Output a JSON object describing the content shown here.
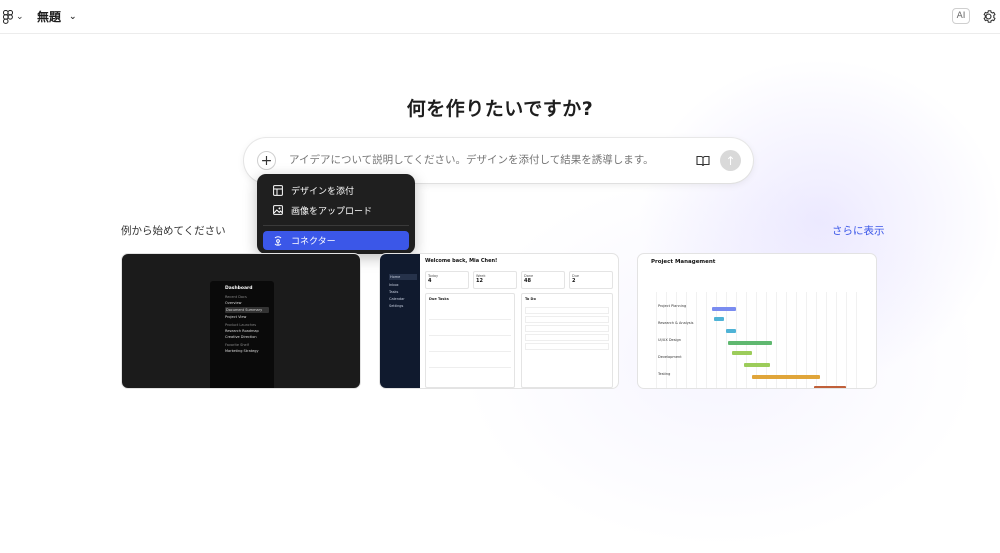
{
  "header": {
    "file_title": "無題",
    "ai_label": "AI",
    "icons": [
      "figma-logo-icon",
      "chevron-down-icon",
      "gear-icon"
    ]
  },
  "main": {
    "heading": "何を作りたいですか?",
    "prompt_placeholder": "アイデアについて説明してください。デザインを添付して結果を誘導します。"
  },
  "attach_menu": {
    "items": [
      {
        "label": "デザインを添付",
        "icon": "design-attach-icon"
      },
      {
        "label": "画像をアップロード",
        "icon": "image-icon"
      },
      {
        "label": "コネクター",
        "icon": "connector-icon",
        "active": true
      }
    ]
  },
  "examples": {
    "title": "例から始めてください",
    "more_label": "さらに表示",
    "cards": [
      {
        "name": "dashboard-dark",
        "title": "Dashboard",
        "sections": [
          "Recent Docs",
          "Product Launches",
          "Favorite Shelf"
        ],
        "items": [
          "Overview",
          "Document Summary",
          "Project View",
          "Research Roadmap",
          "Creative Direction",
          "Marketing Strategy"
        ]
      },
      {
        "name": "task-app",
        "greeting": "Welcome back, Mia Chen!",
        "nav": [
          "Home",
          "Inbox",
          "Tasks",
          "Calendar",
          "Settings"
        ],
        "stats": [
          {
            "label": "Today",
            "value": "4"
          },
          {
            "label": "Week",
            "value": "12"
          },
          {
            "label": "Done",
            "value": "48"
          },
          {
            "label": "Due",
            "value": "2"
          }
        ],
        "sections": [
          "Due Tasks",
          "To Do"
        ]
      },
      {
        "name": "project-management",
        "title": "Project Management",
        "rows": [
          "Project Planning",
          "Research & Analysis",
          "UI/UX Design",
          "Development",
          "Testing"
        ]
      }
    ]
  },
  "colors": {
    "accent": "#3b57e8",
    "menu_bg": "#1f1f1f",
    "gantt": [
      "#7a8cf0",
      "#4fb3d6",
      "#5fb870",
      "#9ccc5a",
      "#e0a53a",
      "#c0603a"
    ]
  }
}
